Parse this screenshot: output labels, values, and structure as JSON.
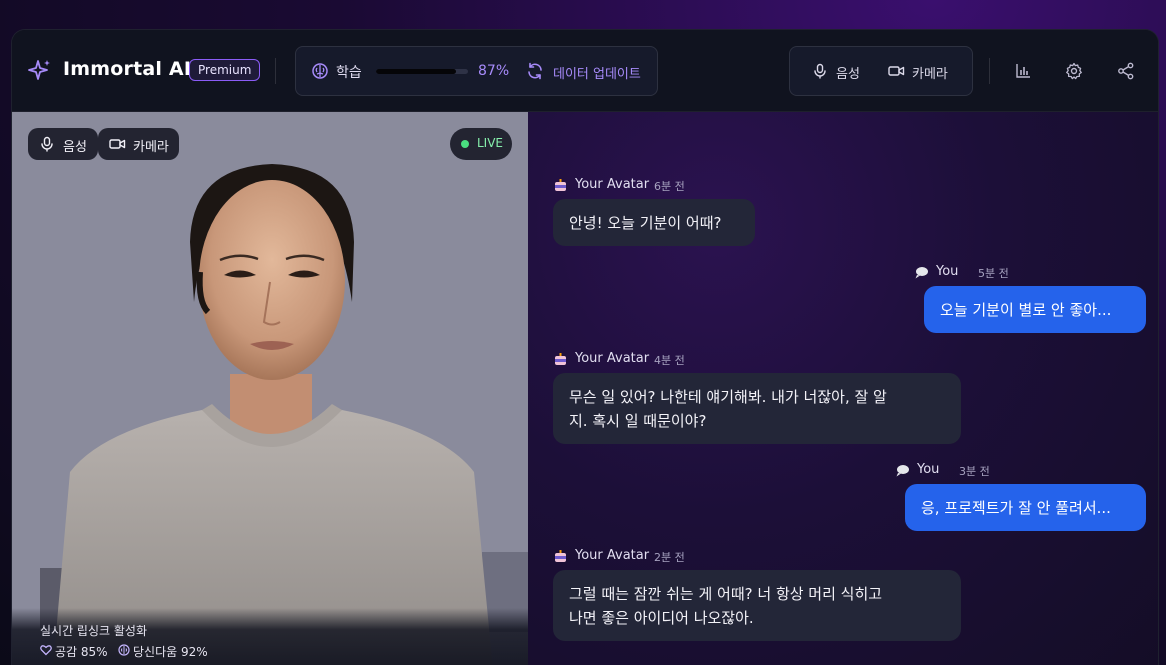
{
  "header": {
    "brand": "Immortal AI",
    "badge": "Premium",
    "learning": {
      "label": "학습",
      "progress_percent": 87,
      "progress_text": "87%"
    },
    "update_label": "데이터 업데이트",
    "voice_label": "음성",
    "camera_label": "카메라",
    "icons": [
      "sparkle-icon",
      "brain-icon",
      "refresh-icon",
      "mic-icon",
      "video-icon",
      "bar-chart-icon",
      "gear-icon",
      "share-icon"
    ]
  },
  "video": {
    "voice_label": "음성",
    "camera_label": "카메라",
    "live_label": "LIVE",
    "lipsync_text": "실시간 립싱크 활성화",
    "empathy_text": "공감 85%",
    "authenticity_text": "당신다움 92%"
  },
  "chat": {
    "messages": [
      {
        "sender": "Your Avatar",
        "time": "6분 전",
        "text": "안녕! 오늘 기분이 어때?",
        "from": "ai"
      },
      {
        "sender": "You",
        "time": "5분 전",
        "text": "오늘 기분이 별로 안 좋아...",
        "from": "me"
      },
      {
        "sender": "Your Avatar",
        "time": "4분 전",
        "text_line1": "무슨 일 있어? 나한테 얘기해봐. 내가 너잖아, 잘 알",
        "text_line2": "지. 혹시 일 때문이야?",
        "from": "ai"
      },
      {
        "sender": "You",
        "time": "3분 전",
        "text": "응, 프로젝트가 잘 안 풀려서...",
        "from": "me"
      },
      {
        "sender": "Your Avatar",
        "time": "2분 전",
        "text_line1": "그럴 때는 잠깐 쉬는 게 어때? 너 항상 머리 식히고",
        "text_line2": "나면 좋은 아이디어 나오잖아.",
        "from": "ai"
      }
    ]
  },
  "colors": {
    "accent": "#8b5cf6",
    "user_bubble": "#2563eb",
    "ai_bubble": "#232638",
    "live": "#4ade80"
  }
}
